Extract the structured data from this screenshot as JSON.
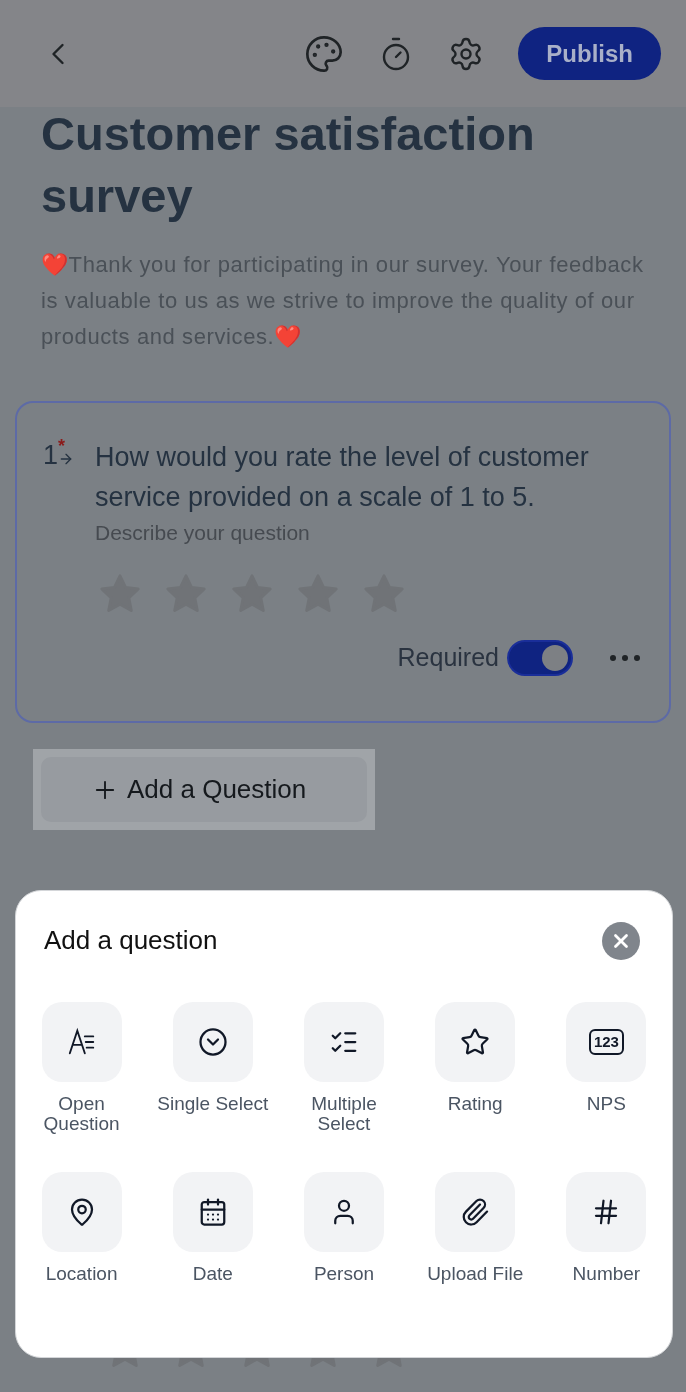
{
  "top_bar": {
    "publish_label": "Publish"
  },
  "survey": {
    "title": "Customer satisfaction survey",
    "description": "❤️Thank you for participating in our survey. Your feedback is valuable to us as we strive to improve the quality of our products and services.❤️"
  },
  "question": {
    "number": "1",
    "required_mark": "*",
    "title": "How would you rate the level of customer service provided on a scale of 1 to 5.",
    "placeholder": "Describe your question",
    "required_label": "Required",
    "required_on": true
  },
  "add_question_button": {
    "label": "Add a Question"
  },
  "sheet": {
    "title": "Add a question",
    "types": [
      {
        "kind": "open",
        "label": "Open Question"
      },
      {
        "kind": "single",
        "label": "Single Select"
      },
      {
        "kind": "multiple",
        "label": "Multiple Select"
      },
      {
        "kind": "rating",
        "label": "Rating"
      },
      {
        "kind": "nps",
        "label": "NPS",
        "icon_text": "123"
      },
      {
        "kind": "location",
        "label": "Location"
      },
      {
        "kind": "date",
        "label": "Date"
      },
      {
        "kind": "person",
        "label": "Person"
      },
      {
        "kind": "file",
        "label": "Upload File"
      },
      {
        "kind": "number",
        "label": "Number"
      }
    ]
  }
}
